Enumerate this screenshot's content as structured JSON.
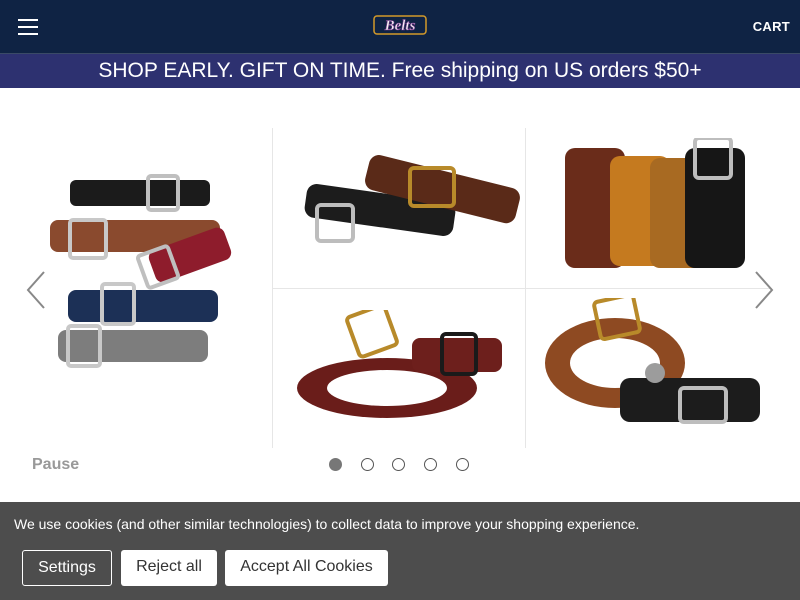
{
  "header": {
    "logo_text": "Belts",
    "cart_label": "CART",
    "menu_icon": "hamburger-menu-icon",
    "background": "#0f2344"
  },
  "promo": {
    "text": "SHOP EARLY. GIFT ON TIME. Free shipping on US orders $50+",
    "background": "#2d3170"
  },
  "carousel": {
    "pause_label": "Pause",
    "prev_icon": "chevron-left-icon",
    "next_icon": "chevron-right-icon",
    "dot_count": 5,
    "active_dot": 1
  },
  "cookie_banner": {
    "text": "We use cookies (and other similar technologies) to collect data to improve your shopping experience.",
    "settings_label": "Settings",
    "reject_label": "Reject all",
    "accept_label": "Accept All Cookies",
    "background": "#4d4d4d"
  }
}
